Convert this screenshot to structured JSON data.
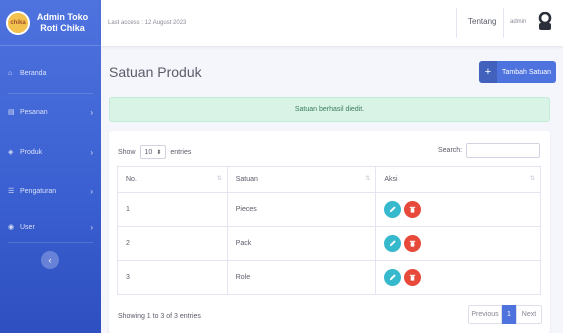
{
  "brand": {
    "name_line1": "Admin Toko",
    "name_line2": "Roti Chika",
    "logo_text": "chika"
  },
  "sidebar": {
    "items": [
      {
        "label": "Beranda",
        "icon": "home-icon",
        "has_chevron": false
      },
      {
        "label": "Pesanan",
        "icon": "file-icon",
        "has_chevron": true
      },
      {
        "label": "Produk",
        "icon": "tag-icon",
        "has_chevron": true
      },
      {
        "label": "Pengaturan",
        "icon": "list-icon",
        "has_chevron": true
      },
      {
        "label": "User",
        "icon": "users-icon",
        "has_chevron": true
      }
    ],
    "toggle_glyph": "‹"
  },
  "topbar": {
    "last_access": "Last access : 12 August 2023",
    "tentang": "Tentang",
    "username": "admin"
  },
  "page": {
    "title": "Satuan Produk",
    "add_button": "Tambah Satuan",
    "alert": "Satuan berhasil diedit."
  },
  "table_controls": {
    "show_label": "Show",
    "entries_value": "10",
    "entries_label": "entries",
    "search_label": "Search:"
  },
  "table": {
    "headers": {
      "no": "No.",
      "satuan": "Satuan",
      "aksi": "Aksi"
    },
    "rows": [
      {
        "no": "1",
        "satuan": "Pieces"
      },
      {
        "no": "2",
        "satuan": "Pack"
      },
      {
        "no": "3",
        "satuan": "Role"
      }
    ]
  },
  "footer": {
    "info": "Showing 1 to 3 of 3 entries",
    "prev": "Previous",
    "page": "1",
    "next": "Next"
  },
  "colors": {
    "primary": "#4e73df",
    "edit": "#36b9cc",
    "delete": "#e74a3b",
    "alert_bg": "#d9f3e6"
  }
}
